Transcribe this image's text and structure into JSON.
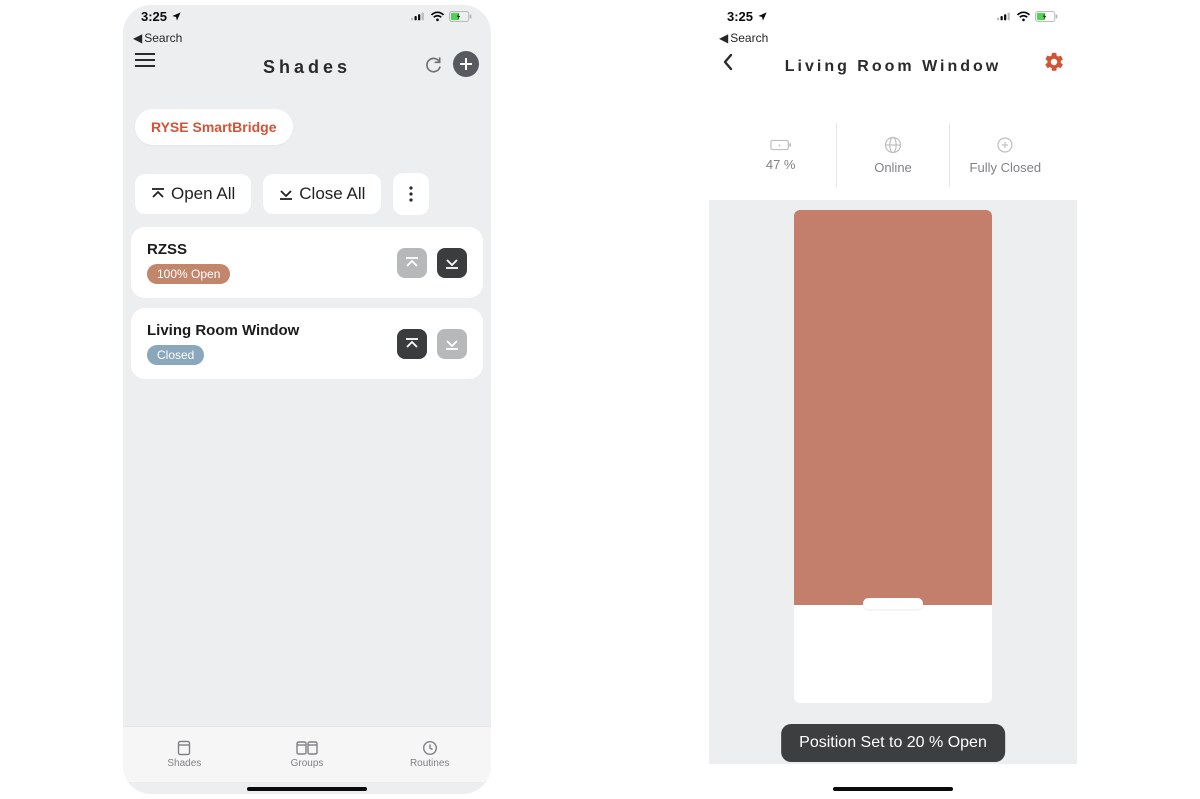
{
  "status": {
    "time": "3:25",
    "back_search": "Search"
  },
  "left": {
    "title": "Shades",
    "chip": "RYSE SmartBridge",
    "open_all": "Open All",
    "close_all": "Close All",
    "shades": [
      {
        "name": "RZSS",
        "status": "100% Open",
        "status_kind": "open",
        "up_active": false,
        "down_active": true
      },
      {
        "name": "Living Room Window",
        "status": "Closed",
        "status_kind": "closed",
        "up_active": true,
        "down_active": false
      }
    ],
    "tabs": {
      "shades": "Shades",
      "groups": "Groups",
      "routines": "Routines"
    }
  },
  "right": {
    "title": "Living Room Window",
    "stats": {
      "battery": "47 %",
      "network": "Online",
      "position": "Fully Closed"
    },
    "toast": "Position Set to 20 % Open"
  }
}
